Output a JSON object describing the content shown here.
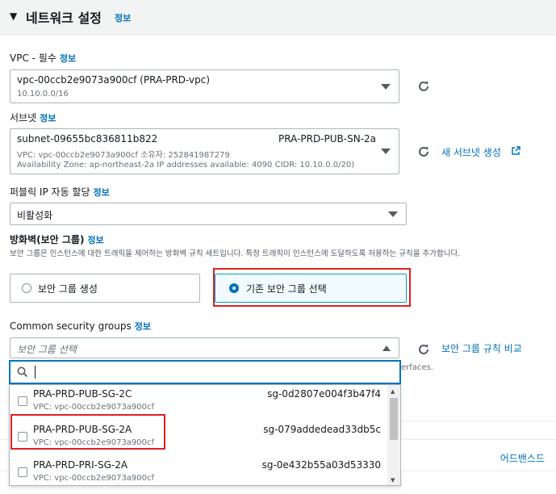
{
  "header": {
    "title": "네트워크 설정",
    "info": "정보"
  },
  "vpc": {
    "label": "VPC - 필수",
    "info": "정보",
    "value": "vpc-00ccb2e9073a900cf (PRA-PRD-vpc)",
    "cidr": "10.10.0.0/16"
  },
  "subnet": {
    "label": "서브넷",
    "info": "정보",
    "id": "subnet-09655bc836811b822",
    "name": "PRA-PRD-PUB-SN-2a",
    "line2": "VPC: vpc-00ccb2e9073a900cf     소유자: 252841987279",
    "line3": "Availability Zone: ap-northeast-2a    IP addresses available: 4090    CIDR: 10.10.0.0/20)",
    "create_link": "새 서브넷 생성"
  },
  "public_ip": {
    "label": "퍼블릭 IP 자동 할당",
    "info": "정보",
    "value": "비활성화"
  },
  "firewall": {
    "label": "방화벽(보안 그룹)",
    "info": "정보",
    "description": "보안 그룹은 인스턴스에 대한 트래픽을 제어하는 방화벽 규칙 세트입니다. 특정 트래픽이 인스턴스에 도달하도록 허용하는 규칙을 추가합니다.",
    "option_create": "보안 그룹 생성",
    "option_existing": "기존 보안 그룹 선택"
  },
  "common_sg": {
    "label": "Common security groups",
    "info": "정보",
    "placeholder": "보안 그룹 선택",
    "compare_link": "보안 그룹 규칙 비교",
    "behind_text": "erfaces.",
    "search_value": ""
  },
  "sg_options": [
    {
      "name": "PRA-PRD-PUB-SG-2C",
      "vpc": "VPC: vpc-00ccb2e9073a900cf",
      "sg": "sg-0d2807e004f3b47f4"
    },
    {
      "name": "PRA-PRD-PUB-SG-2A",
      "vpc": "VPC: vpc-00ccb2e9073a900cf",
      "sg": "sg-079addedead33db5c"
    },
    {
      "name": "PRA-PRD-PRI-SG-2A",
      "vpc": "VPC: vpc-00ccb2e9073a900cf",
      "sg": "sg-0e432b55a03d53330"
    }
  ],
  "advanced": {
    "label": "어드밴스드"
  },
  "colors": {
    "link": "#0073bb",
    "highlight": "#e02020",
    "selected_border": "#00a1c9"
  },
  "icons": [
    "caret-down-icon",
    "refresh-icon",
    "external-link-icon",
    "search-icon",
    "caret-up-icon"
  ]
}
